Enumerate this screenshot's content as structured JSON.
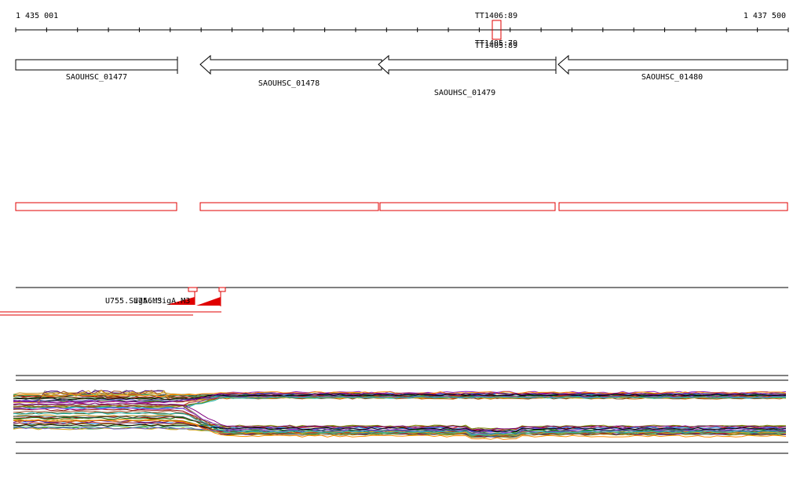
{
  "ruler": {
    "start_label": "1 435 001",
    "end_label": "1 437 500",
    "start": 1435001,
    "end": 1437500,
    "tick_count": 25
  },
  "terminator": {
    "label": "TT1406:89",
    "shadow_label": "TT1405:79",
    "shadow_label_2": "TT1405:89",
    "position": 1436560
  },
  "genes": [
    {
      "name": "SAOUHSC_01477",
      "start": 1435001,
      "end": 1435525,
      "strand": "+"
    },
    {
      "name": "SAOUHSC_01478",
      "start": 1435600,
      "end": 1436185,
      "strand": "-"
    },
    {
      "name": "SAOUHSC_01479",
      "start": 1436185,
      "end": 1436752,
      "strand": "-"
    },
    {
      "name": "SAOUHSC_01480",
      "start": 1436765,
      "end": 1437500,
      "strand": "-"
    }
  ],
  "promoters": {
    "label_1": "U755.SigA.M3",
    "label_2": "U756.SigA.M3",
    "positions": [
      1435564,
      1435658
    ]
  },
  "colors": {
    "gene_stroke": "#000000",
    "annotation_stroke": "#e00000",
    "promoter_fill": "#e00000"
  },
  "expression_track": {
    "series_count": 48
  }
}
